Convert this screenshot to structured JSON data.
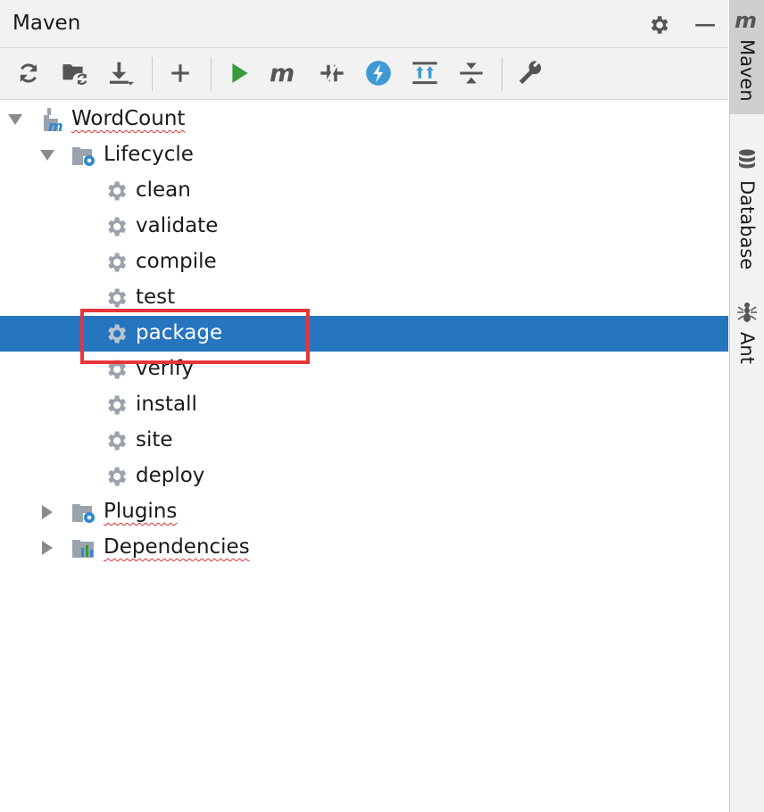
{
  "panel": {
    "title": "Maven",
    "header_icons": [
      "gear-icon",
      "minimize-icon"
    ]
  },
  "toolbar": {
    "tools": [
      {
        "name": "reload-icon",
        "tooltip": ""
      },
      {
        "name": "folder-reload-icon"
      },
      {
        "name": "download-icon"
      },
      {
        "name": "add-icon"
      },
      {
        "name": "run-icon"
      },
      {
        "name": "maven-goal-icon"
      },
      {
        "name": "toggle-offline-icon"
      },
      {
        "name": "skip-tests-icon"
      },
      {
        "name": "show-dependencies-icon"
      },
      {
        "name": "collapse-all-icon"
      },
      {
        "name": "settings-wrench-icon"
      }
    ]
  },
  "tree": {
    "project": "WordCount",
    "lifecycle": {
      "label": "Lifecycle",
      "goals": [
        "clean",
        "validate",
        "compile",
        "test",
        "package",
        "verify",
        "install",
        "site",
        "deploy"
      ],
      "selected": "package"
    },
    "plugins": "Plugins",
    "dependencies": "Dependencies"
  },
  "sidebar": {
    "tabs": [
      {
        "label": "Maven",
        "active": true
      },
      {
        "label": "Database",
        "active": false
      },
      {
        "label": "Ant",
        "active": false
      }
    ]
  },
  "colors": {
    "selection": "#2675bf",
    "highlight_box": "#e8343a",
    "run_green": "#3a9a3a",
    "accent_blue": "#3d9ad6"
  }
}
